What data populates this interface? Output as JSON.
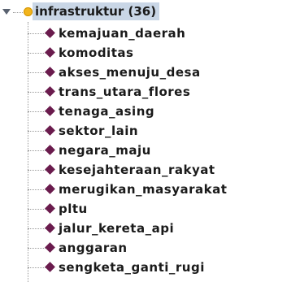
{
  "tree": {
    "root": {
      "label": "infrastruktur (36)",
      "expanded": true,
      "icon": "yellow-circle-icon",
      "color": "#f2b41c"
    },
    "children": [
      {
        "label": "kemajuan_daerah"
      },
      {
        "label": "komoditas"
      },
      {
        "label": "akses_menuju_desa"
      },
      {
        "label": "trans_utara_flores"
      },
      {
        "label": "tenaga_asing"
      },
      {
        "label": "sektor_lain"
      },
      {
        "label": "negara_maju"
      },
      {
        "label": "kesejahteraan_rakyat"
      },
      {
        "label": "merugikan_masyarakat"
      },
      {
        "label": "pltu"
      },
      {
        "label": "jalur_kereta_api"
      },
      {
        "label": "anggaran"
      },
      {
        "label": "sengketa_ganti_rugi"
      }
    ],
    "child_icon": "purple-diamond-icon",
    "child_icon_color": "#6a1b4d",
    "selection_color": "#c9d6e6"
  }
}
